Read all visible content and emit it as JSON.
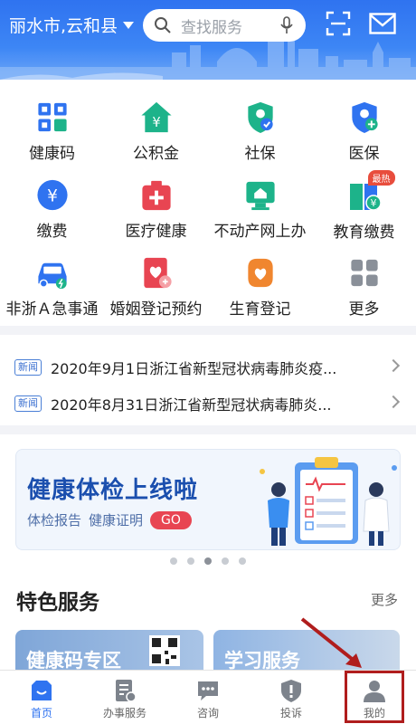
{
  "header": {
    "location": "丽水市,云和县",
    "search_placeholder": "查找服务"
  },
  "grid": [
    {
      "label": "健康码",
      "icon": "health-code-icon",
      "color": "#2f73f0"
    },
    {
      "label": "公积金",
      "icon": "housing-fund-icon",
      "color": "#1db38a"
    },
    {
      "label": "社保",
      "icon": "social-security-icon",
      "color": "#1db38a"
    },
    {
      "label": "医保",
      "icon": "medical-insurance-icon",
      "color": "#2f73f0"
    },
    {
      "label": "缴费",
      "icon": "payment-icon",
      "color": "#2f73f0"
    },
    {
      "label": "医疗健康",
      "icon": "medical-kit-icon",
      "color": "#e84552"
    },
    {
      "label": "不动产网上办",
      "icon": "real-estate-icon",
      "color": "#1db38a"
    },
    {
      "label": "教育缴费",
      "icon": "education-payment-icon",
      "color": "#1db38a",
      "badge": "最热"
    },
    {
      "label": "非浙Ａ急事通",
      "icon": "car-icon",
      "color": "#2f73f0"
    },
    {
      "label": "婚姻登记预约",
      "icon": "marriage-registration-icon",
      "color": "#e84552"
    },
    {
      "label": "生育登记",
      "icon": "birth-registration-icon",
      "color": "#f0862f"
    },
    {
      "label": "更多",
      "icon": "more-grid-icon",
      "color": "#8a9099"
    }
  ],
  "news": {
    "tag": "新闻",
    "items": [
      "2020年9月1日浙江省新型冠状病毒肺炎疫...",
      "2020年8月31日浙江省新型冠状病毒肺炎..."
    ]
  },
  "banner": {
    "title": "健康体检上线啦",
    "sub1": "体检报告",
    "sub2": "健康证明",
    "go": "GO",
    "active_dot": 2
  },
  "special": {
    "title": "特色服务",
    "more": "更多",
    "cards": [
      "健康码专区",
      "学习服务"
    ]
  },
  "nav": [
    {
      "label": "首页",
      "icon": "home-icon",
      "active": true
    },
    {
      "label": "办事服务",
      "icon": "services-icon",
      "active": false
    },
    {
      "label": "咨询",
      "icon": "consult-icon",
      "active": false
    },
    {
      "label": "投诉",
      "icon": "complaint-icon",
      "active": false
    },
    {
      "label": "我的",
      "icon": "profile-icon",
      "active": false
    }
  ]
}
